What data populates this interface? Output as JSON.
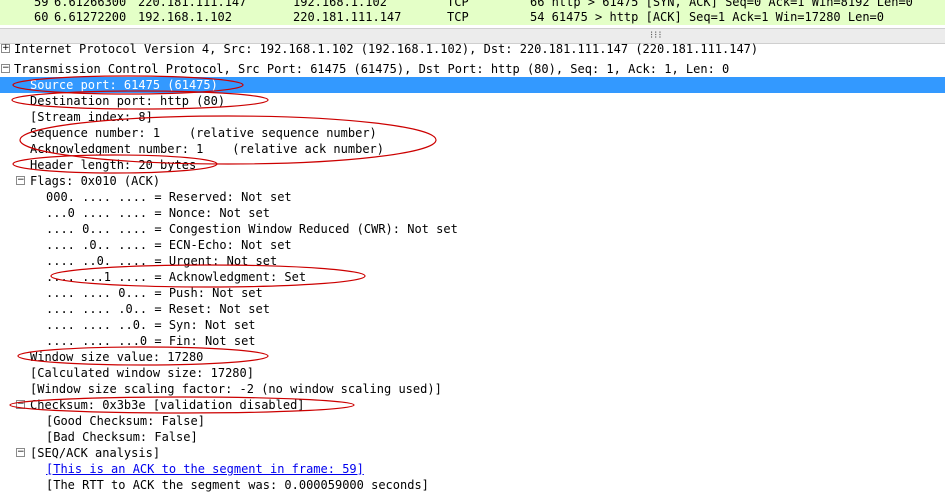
{
  "packet_list": {
    "rows": [
      {
        "no": "59",
        "time": "6.61266300",
        "source": "220.181.111.147",
        "destination": "192.168.1.102",
        "protocol": "TCP",
        "info": "66 http > 61475 [SYN, ACK] Seq=0 Ack=1 Win=8192 Len=0"
      },
      {
        "no": "60",
        "time": "6.61272200",
        "source": "192.168.1.102",
        "destination": "220.181.111.147",
        "protocol": "TCP",
        "info": "54 61475 > http [ACK] Seq=1 Ack=1 Win=17280 Len=0"
      }
    ],
    "divider_grip": "⁝⁝⁝"
  },
  "detail_tree": {
    "ip_header": "Internet Protocol Version 4, Src: 192.168.1.102 (192.168.1.102), Dst: 220.181.111.147 (220.181.111.147)",
    "tcp_header": "Transmission Control Protocol, Src Port: 61475 (61475), Dst Port: http (80), Seq: 1, Ack: 1, Len: 0",
    "source_port": "Source port: 61475 (61475)",
    "destination_port": "Destination port: http (80)",
    "stream_index": "[Stream index: 8]",
    "sequence_number": "Sequence number: 1    (relative sequence number)",
    "ack_number": "Acknowledgment number: 1    (relative ack number)",
    "header_length": "Header length: 20 bytes",
    "flags": "Flags: 0x010 (ACK)",
    "flag_lines": [
      "000. .... .... = Reserved: Not set",
      "...0 .... .... = Nonce: Not set",
      ".... 0... .... = Congestion Window Reduced (CWR): Not set",
      ".... .0.. .... = ECN-Echo: Not set",
      ".... ..0. .... = Urgent: Not set",
      ".... ...1 .... = Acknowledgment: Set",
      ".... .... 0... = Push: Not set",
      ".... .... .0.. = Reset: Not set",
      ".... .... ..0. = Syn: Not set",
      ".... .... ...0 = Fin: Not set"
    ],
    "window_size": "Window size value: 17280",
    "calc_window": "[Calculated window size: 17280]",
    "scaling_factor": "[Window size scaling factor: -2 (no window scaling used)]",
    "checksum": "Checksum: 0x3b3e [validation disabled]",
    "good_checksum": "[Good Checksum: False]",
    "bad_checksum": "[Bad Checksum: False]",
    "seq_ack": "[SEQ/ACK analysis]",
    "ack_link": "[This is an ACK to the segment in frame: 59]",
    "rtt": "[The RTT to ACK the segment was: 0.000059000 seconds]"
  },
  "tree_toggles": {
    "collapsed": "+",
    "expanded": "−"
  },
  "colors": {
    "selection": "#3399ff",
    "packet_row": "#e4ffc7",
    "annotation": "#cc0000",
    "link": "#0000ee"
  }
}
